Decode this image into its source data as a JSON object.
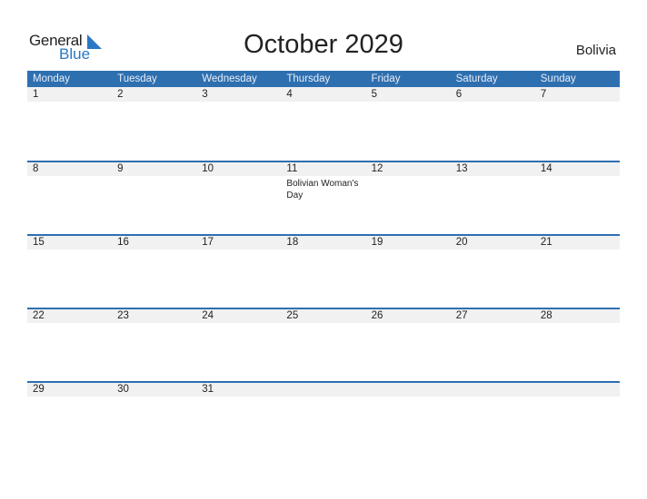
{
  "logo": {
    "general": "General",
    "blue": "Blue",
    "brand_color": "#2a78c5"
  },
  "title": "October 2029",
  "country": "Bolivia",
  "header_color": "#2e6fb0",
  "days": [
    "Monday",
    "Tuesday",
    "Wednesday",
    "Thursday",
    "Friday",
    "Saturday",
    "Sunday"
  ],
  "weeks": [
    {
      "days": [
        {
          "n": "1"
        },
        {
          "n": "2"
        },
        {
          "n": "3"
        },
        {
          "n": "4"
        },
        {
          "n": "5"
        },
        {
          "n": "6"
        },
        {
          "n": "7"
        }
      ]
    },
    {
      "days": [
        {
          "n": "8"
        },
        {
          "n": "9"
        },
        {
          "n": "10"
        },
        {
          "n": "11",
          "event": "Bolivian Woman's Day"
        },
        {
          "n": "12"
        },
        {
          "n": "13"
        },
        {
          "n": "14"
        }
      ]
    },
    {
      "days": [
        {
          "n": "15"
        },
        {
          "n": "16"
        },
        {
          "n": "17"
        },
        {
          "n": "18"
        },
        {
          "n": "19"
        },
        {
          "n": "20"
        },
        {
          "n": "21"
        }
      ]
    },
    {
      "days": [
        {
          "n": "22"
        },
        {
          "n": "23"
        },
        {
          "n": "24"
        },
        {
          "n": "25"
        },
        {
          "n": "26"
        },
        {
          "n": "27"
        },
        {
          "n": "28"
        }
      ]
    },
    {
      "days": [
        {
          "n": "29"
        },
        {
          "n": "30"
        },
        {
          "n": "31"
        },
        {
          "n": ""
        },
        {
          "n": ""
        },
        {
          "n": ""
        },
        {
          "n": ""
        }
      ]
    }
  ]
}
